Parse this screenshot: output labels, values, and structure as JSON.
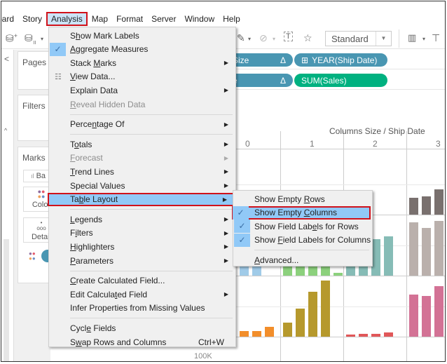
{
  "menubar": {
    "items": [
      {
        "label": "oard"
      },
      {
        "label": "Story"
      },
      {
        "label": "Analysis",
        "active": true
      },
      {
        "label": "Map"
      },
      {
        "label": "Format"
      },
      {
        "label": "Server"
      },
      {
        "label": "Window"
      },
      {
        "label": "Help"
      }
    ]
  },
  "toolbar": {
    "view_size": "Standard",
    "icons": [
      "new-datasource-icon",
      "pause-datasource-icon",
      "highlight-pen-icon",
      "attach-icon",
      "text-label-icon",
      "pin-icon",
      "show-me-icon",
      "presentation-icon"
    ]
  },
  "panes": {
    "collapse_glyph": "<",
    "pages": "Pages",
    "filters": "Filters",
    "marks": "Marks",
    "mark_type": "Ba",
    "color": "Color",
    "detail": "Detail"
  },
  "shelves": {
    "columns": [
      {
        "label": "Size",
        "type": "dimension",
        "delta": "Δ"
      },
      {
        "label": "YEAR(Ship Date)",
        "type": "dimension",
        "prefix": "⊞"
      }
    ],
    "rows": [
      {
        "label": "e",
        "type": "dimension",
        "delta": "Δ"
      },
      {
        "label": "SUM(Sales)",
        "type": "measure"
      }
    ]
  },
  "view": {
    "column_field_title": "Columns Size / Ship Date",
    "column_headers": [
      "0",
      "1",
      "2",
      "3"
    ],
    "axis_tick": "100K"
  },
  "analysis_menu": {
    "items": [
      {
        "label": "Show Mark Labels",
        "ul": 1
      },
      {
        "label": "Aggregate Measures",
        "checked": true,
        "ul": 0
      },
      {
        "label": "Stack Marks",
        "submenu": true,
        "ul": 6
      },
      {
        "label": "View Data...",
        "icon": "view-data-icon",
        "ul": 0
      },
      {
        "label": "Explain Data",
        "submenu": true
      },
      {
        "label": "Reveal Hidden Data",
        "disabled": true,
        "ul": 0
      },
      {
        "separator": true
      },
      {
        "label": "Percentage Of",
        "submenu": true,
        "ul": 5
      },
      {
        "separator": true
      },
      {
        "label": "Totals",
        "submenu": true,
        "ul": 1
      },
      {
        "label": "Forecast",
        "submenu": true,
        "disabled": true,
        "ul": 0
      },
      {
        "label": "Trend Lines",
        "submenu": true,
        "ul": 0
      },
      {
        "label": "Special Values",
        "submenu": true
      },
      {
        "label": "Table Layout",
        "submenu": true,
        "highlighted": true,
        "ul": 2
      },
      {
        "separator": true
      },
      {
        "label": "Legends",
        "submenu": true,
        "ul": 0
      },
      {
        "label": "Filters",
        "submenu": true,
        "ul": 1
      },
      {
        "label": "Highlighters",
        "submenu": true,
        "ul": 0
      },
      {
        "label": "Parameters",
        "submenu": true,
        "ul": 0
      },
      {
        "separator": true
      },
      {
        "label": "Create Calculated Field...",
        "ul": 0
      },
      {
        "label": "Edit Calculated Field",
        "submenu": true,
        "ul": 12
      },
      {
        "label": "Infer Properties from Missing Values"
      },
      {
        "separator": true
      },
      {
        "label": "Cycle Fields",
        "ul": 4
      },
      {
        "label": "Swap Rows and Columns",
        "shortcut": "Ctrl+W",
        "ul": 1
      }
    ]
  },
  "table_layout_submenu": {
    "items": [
      {
        "label": "Show Empty Rows",
        "ul": 11
      },
      {
        "label": "Show Empty Columns",
        "checked": true,
        "highlighted": true,
        "ul": 11
      },
      {
        "label": "Show Field Labels for Rows",
        "checked": true,
        "ul": 14
      },
      {
        "label": "Show Field Labels for Columns",
        "checked": true,
        "ul": 5
      },
      {
        "separator": true
      },
      {
        "label": "Advanced...",
        "ul": 0
      }
    ]
  },
  "colors": {
    "highlight": "#91c9f7",
    "callout_red": "#d0121b",
    "dimension_pill": "#4996b2",
    "measure_pill": "#00b180"
  },
  "chart_data": {
    "type": "bar",
    "title": "Columns Size / Ship Date",
    "column_panes": [
      "0",
      "1",
      "2",
      "3"
    ],
    "row_panes": [
      {
        "name": "row-1",
        "bars": [
          [
            0.35
          ],
          [],
          [
            0.05,
            0.12
          ],
          [
            0.3,
            0.32,
            0.45
          ]
        ],
        "colors": [
          "#4e79a7",
          "#59a14f",
          "#499894",
          "#79706e"
        ]
      },
      {
        "name": "row-2",
        "bars": [
          [
            0.55,
            0.55,
            0.55
          ],
          [
            0.85,
            0.85,
            0.85,
            0.85,
            0.05
          ],
          [
            0.3,
            0.45,
            0.65,
            0.7
          ],
          [
            0.95,
            0.85,
            0.97
          ]
        ],
        "colors": [
          "#a0cbe8",
          "#8cd17d",
          "#86bcb6",
          "#bab0ac"
        ]
      },
      {
        "name": "row-3",
        "bars": [
          [
            0.08,
            0.1,
            0.1,
            0.18
          ],
          [
            0.25,
            0.5,
            0.8,
            1.0
          ],
          [
            0.04,
            0.05,
            0.05,
            0.07
          ],
          [
            0.75,
            0.72,
            0.9
          ]
        ],
        "colors": [
          "#f28e2b",
          "#b6992d",
          "#e15759",
          "#d37295"
        ]
      }
    ],
    "axis_tick": "100K"
  }
}
